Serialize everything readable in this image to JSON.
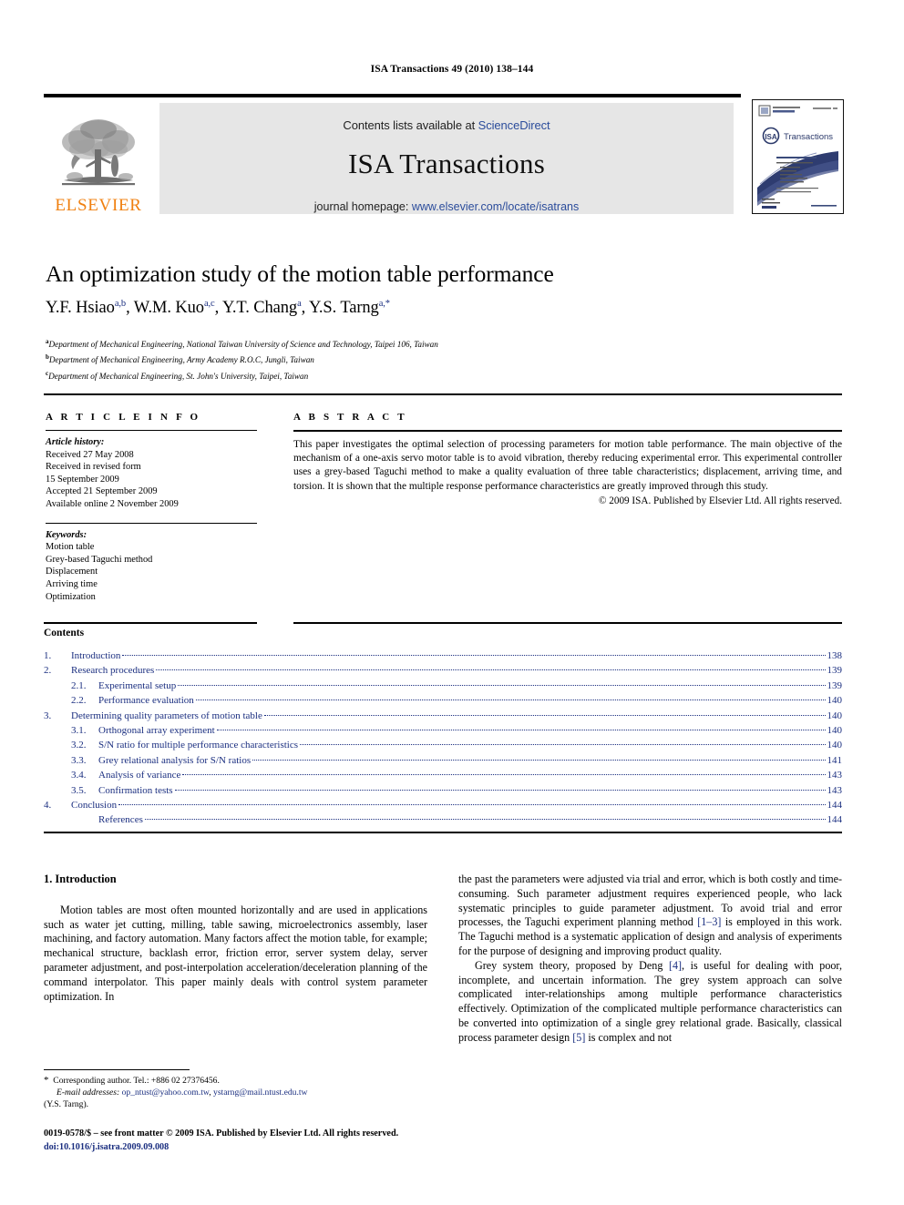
{
  "running_head": "ISA Transactions 49 (2010) 138–144",
  "masthead": {
    "contents_prefix": "Contents lists available at ",
    "sciencedirect": "ScienceDirect",
    "journal_name": "ISA Transactions",
    "homepage_prefix": "journal homepage: ",
    "homepage_url": "www.elsevier.com/locate/isatrans",
    "publisher_wordmark": "ELSEVIER",
    "publisher_logo_icon": "elsevier-tree-icon",
    "cover_icon": "journal-cover-thumbnail",
    "cover_brand": "Transactions",
    "cover_badge": "ISA",
    "link_color": "#2b4c9b",
    "panel_color": "#e6e6e6",
    "wordmark_color": "#F08010"
  },
  "article": {
    "title": "An optimization study of the motion table performance",
    "authors": [
      {
        "name": "Y.F. Hsiao",
        "sup": "a,b"
      },
      {
        "name": "W.M. Kuo",
        "sup": "a,c"
      },
      {
        "name": "Y.T. Chang",
        "sup": "a"
      },
      {
        "name": "Y.S. Tarng",
        "sup": "a,*"
      }
    ],
    "affiliations": [
      {
        "mark": "a",
        "text": "Department of Mechanical Engineering, National Taiwan University of Science and Technology, Taipei 106, Taiwan"
      },
      {
        "mark": "b",
        "text": "Department of Mechanical Engineering, Army Academy R.O.C, Jungli, Taiwan"
      },
      {
        "mark": "c",
        "text": "Department of Mechanical Engineering, St. John's University, Taipei, Taiwan"
      }
    ]
  },
  "info": {
    "heading": "A R T I C L E   I N F O",
    "history_label": "Article history:",
    "history": [
      "Received 27 May 2008",
      "Received in revised form",
      "15 September 2009",
      "Accepted 21 September 2009",
      "Available online 2 November 2009"
    ],
    "keywords_label": "Keywords:",
    "keywords": [
      "Motion table",
      "Grey-based Taguchi method",
      "Displacement",
      "Arriving time",
      "Optimization"
    ]
  },
  "abstract": {
    "heading": "A B S T R A C T",
    "text": "This paper investigates the optimal selection of processing parameters for motion table performance. The main objective of the mechanism of a one-axis servo motor table is to avoid vibration, thereby reducing experimental error. This experimental controller uses a grey-based Taguchi method to make a quality evaluation of three table characteristics; displacement, arriving time, and torsion. It is shown that the multiple response performance characteristics are greatly improved through this study.",
    "copyright": "© 2009 ISA. Published by Elsevier Ltd. All rights reserved."
  },
  "contents": {
    "heading": "Contents",
    "items": [
      {
        "num": "1.",
        "label": "Introduction",
        "page": "138",
        "level": 1
      },
      {
        "num": "2.",
        "label": "Research procedures",
        "page": "139",
        "level": 1
      },
      {
        "num": "2.1.",
        "label": "Experimental setup",
        "page": "139",
        "level": 2
      },
      {
        "num": "2.2.",
        "label": "Performance evaluation",
        "page": "140",
        "level": 2
      },
      {
        "num": "3.",
        "label": "Determining quality parameters of motion table",
        "page": "140",
        "level": 1
      },
      {
        "num": "3.1.",
        "label": "Orthogonal array experiment",
        "page": "140",
        "level": 2
      },
      {
        "num": "3.2.",
        "label": "S/N ratio for multiple performance characteristics",
        "page": "140",
        "level": 2
      },
      {
        "num": "3.3.",
        "label": "Grey relational analysis for S/N ratios",
        "page": "141",
        "level": 2
      },
      {
        "num": "3.4.",
        "label": "Analysis of variance",
        "page": "143",
        "level": 2
      },
      {
        "num": "3.5.",
        "label": "Confirmation tests",
        "page": "143",
        "level": 2
      },
      {
        "num": "4.",
        "label": "Conclusion",
        "page": "144",
        "level": 1
      },
      {
        "num": "",
        "label": "References",
        "page": "144",
        "level": 2
      }
    ]
  },
  "body": {
    "section_heading": "1.  Introduction",
    "left_paragraph": "Motion tables are most often mounted horizontally and are used in applications such as water jet cutting, milling, table sawing, microelectronics assembly, laser machining, and factory automation. Many factors affect the motion table, for example; mechanical structure, backlash error, friction error, server system delay, server parameter adjustment, and post-interpolation acceleration/deceleration planning of the command interpolator. This paper mainly deals with control system parameter optimization. In",
    "right_paragraph_1_a": "the past the parameters were adjusted via trial and error, which is both costly and time-consuming. Such parameter adjustment requires experienced people, who lack systematic principles to guide parameter adjustment. To avoid trial and error processes, the Taguchi experiment planning method ",
    "right_paragraph_1_ref": "[1–3]",
    "right_paragraph_1_b": " is employed in this work. The Taguchi method is a systematic application of design and analysis of experiments for the purpose of designing and improving product quality.",
    "right_paragraph_2_a": "Grey system theory, proposed by Deng ",
    "right_paragraph_2_ref1": "[4]",
    "right_paragraph_2_b": ", is useful for dealing with poor, incomplete, and uncertain information. The grey system approach can solve complicated inter-relationships among multiple performance characteristics effectively. Optimization of the complicated multiple performance characteristics can be converted into optimization of a single grey relational grade. Basically, classical process parameter design ",
    "right_paragraph_2_ref2": "[5]",
    "right_paragraph_2_c": " is complex and not"
  },
  "footnote": {
    "star": "*",
    "corresponding": "Corresponding author. Tel.: +886 02 27376456.",
    "email_label": "E-mail addresses:",
    "email_1": "op_ntust@yahoo.com.tw",
    "email_sep": ", ",
    "email_2": "ystarng@mail.ntust.edu.tw",
    "email_owner": "(Y.S. Tarng)."
  },
  "imprint": {
    "line1": "0019-0578/$ – see front matter © 2009 ISA. Published by Elsevier Ltd. All rights reserved.",
    "doi": "doi:10.1016/j.isatra.2009.09.008"
  }
}
